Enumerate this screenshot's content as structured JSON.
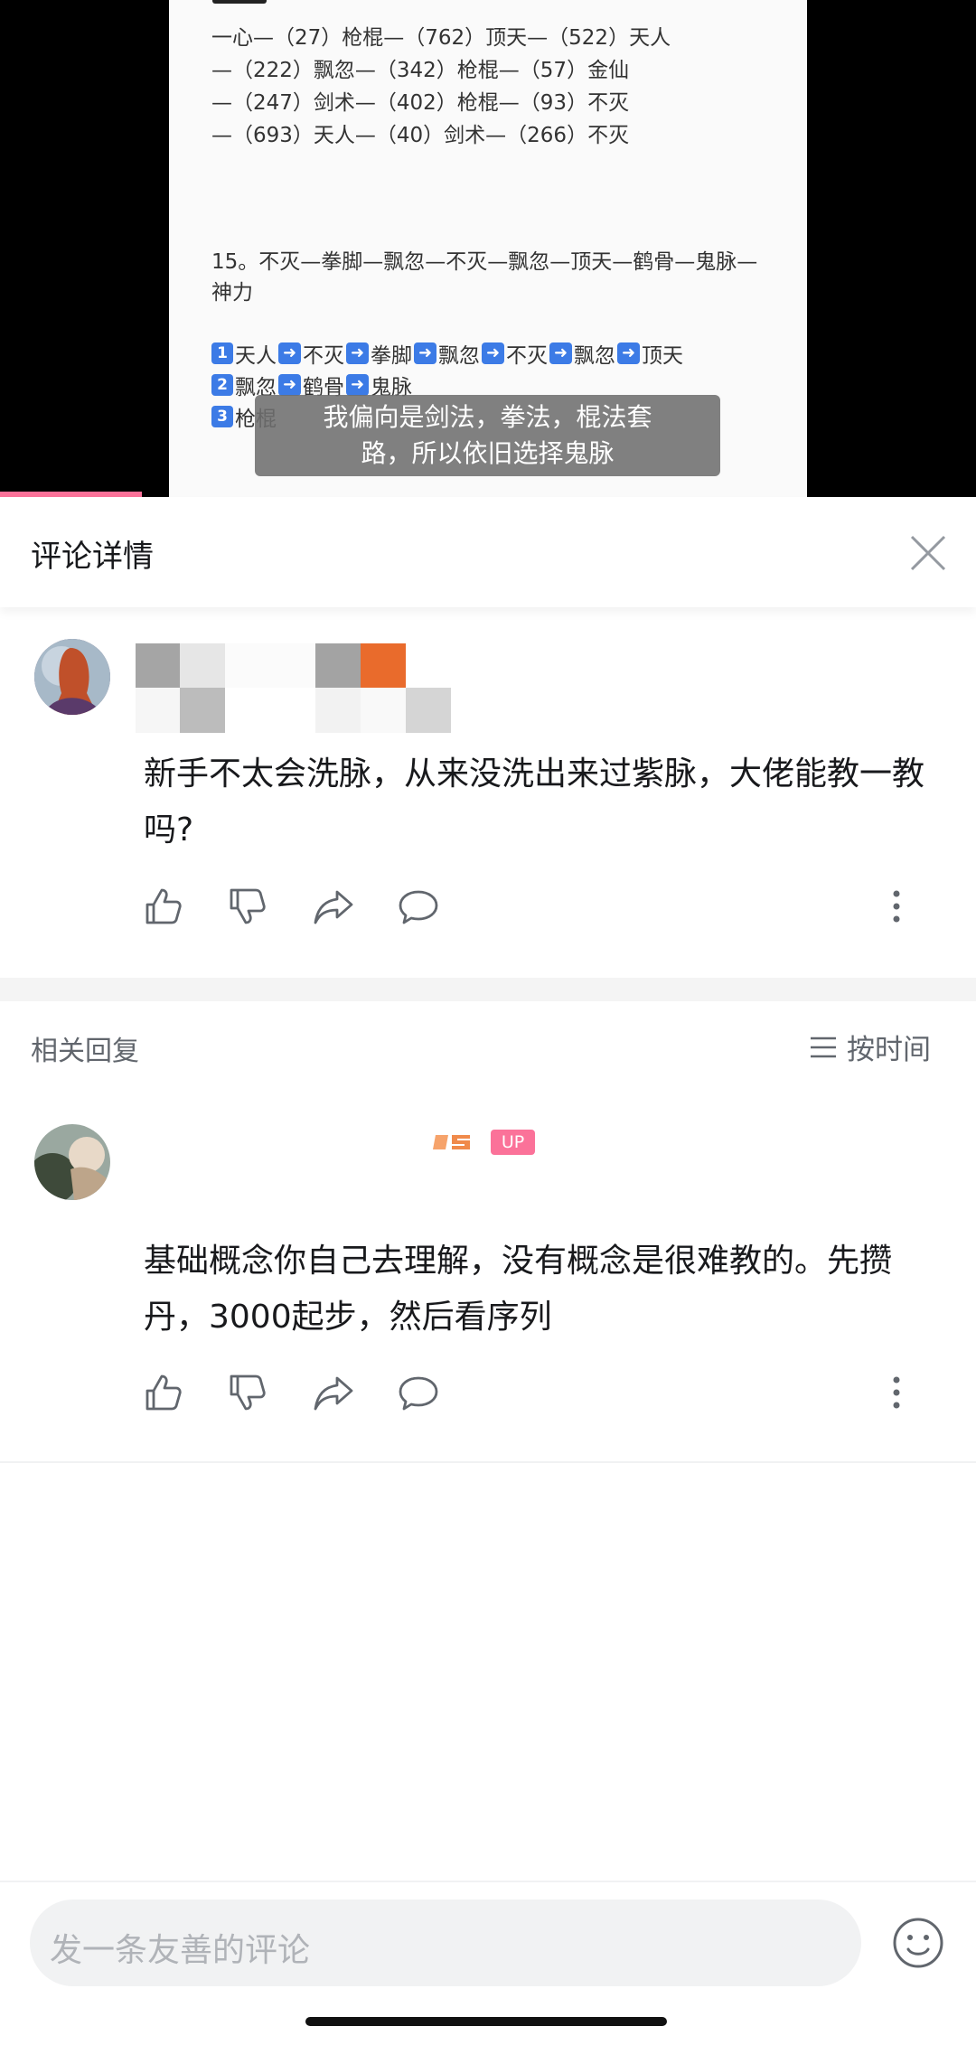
{
  "video": {
    "doc_lines": [
      "一心—（27）枪棍—（762）顶天—（522）天人",
      "—（222）飘忽—（342）枪棍—（57）金仙",
      "—（247）剑术—（402）枪棍—（93）不灭",
      "—（693）天人—（40）剑术—（266）不灭"
    ],
    "step_line1": "15。不灭—拳脚—飘忽—不灭—飘忽—顶天—鹤骨—鬼脉—",
    "step_line2": "神力",
    "seq1": {
      "num": "1",
      "items": [
        "天人",
        "不灭",
        "拳脚",
        "飘忽",
        "不灭",
        "飘忽",
        "顶天"
      ]
    },
    "seq2": {
      "num": "2",
      "items": [
        "飘忽",
        "鹤骨",
        "鬼脉"
      ]
    },
    "seq3": {
      "num": "3",
      "items": [
        "枪棍"
      ]
    },
    "subtitle_line1": "我偏向是剑法，拳法，棍法套",
    "subtitle_line2": "路，所以依旧选择鬼脉",
    "progress_fraction": 0.145
  },
  "header": {
    "title": "评论详情",
    "close_icon": "close-icon"
  },
  "main_comment": {
    "text": "新手不太会洗脉，从来没洗出来过紫脉，大佬能教一教吗?",
    "actions": [
      "like-icon",
      "dislike-icon",
      "share-icon",
      "reply-icon",
      "more-icon"
    ]
  },
  "replies_header": {
    "label": "相关回复",
    "sort_label": "按时间",
    "sort_icon": "list-icon"
  },
  "reply": {
    "badge": "UP",
    "text": "基础概念你自己去理解，没有概念是很难教的。先攒丹，3000起步，然后看序列"
  },
  "footer": {
    "placeholder": "发一条友善的评论",
    "emoji_icon": "emoji-icon"
  },
  "colors": {
    "accent": "#fb7299",
    "text": "#18191c",
    "muted": "#61666d"
  }
}
